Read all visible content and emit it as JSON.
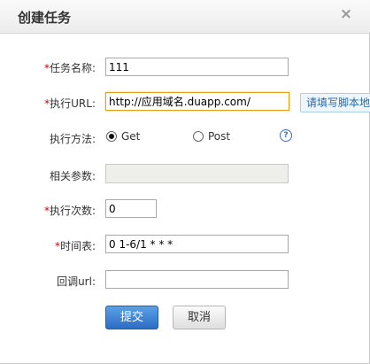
{
  "dialog": {
    "title": "创建任务",
    "close_glyph": "×"
  },
  "form": {
    "task_name": {
      "required_mark": "*",
      "label": "任务名称:",
      "value": "111"
    },
    "exec_url": {
      "required_mark": "*",
      "label": "执行URL:",
      "value": "http://应用域名.duapp.com/",
      "hint": "请填写脚本地"
    },
    "exec_method": {
      "label": "执行方法:",
      "options": [
        "Get",
        "Post"
      ],
      "selected": "Get",
      "help_glyph": "?"
    },
    "params": {
      "label": "相关参数:",
      "value": ""
    },
    "exec_count": {
      "required_mark": "*",
      "label": "执行次数:",
      "value": "0"
    },
    "schedule": {
      "required_mark": "*",
      "label": "时间表:",
      "value": "0 1-6/1 * * *"
    },
    "callback_url": {
      "label": "回调url:",
      "value": ""
    }
  },
  "buttons": {
    "submit": "提交",
    "cancel": "取消"
  },
  "colors": {
    "required": "#cc0000",
    "primary_button": "#2c6dc4",
    "focus_border": "#e0a11a"
  }
}
